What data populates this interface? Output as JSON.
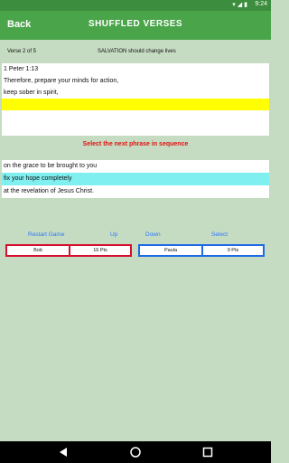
{
  "status": {
    "time": "9:24"
  },
  "header": {
    "back_label": "Back",
    "title": "SHUFFLED VERSES"
  },
  "info": {
    "progress": "Verse  2 of 5",
    "theme": "SALVATION should change lives"
  },
  "verse": {
    "lines": [
      "1 Peter 1:13",
      "Therefore, prepare your minds for action,",
      "keep sober in spirit,",
      "",
      ""
    ]
  },
  "instruction": "Select the next phrase in sequence",
  "options": [
    "on the grace to be brought to you",
    "fix your hope completely",
    "at the revelation of Jesus Christ."
  ],
  "controls": {
    "restart": "Restart Game",
    "up": "Up",
    "down": "Down",
    "select": "Select"
  },
  "players": [
    {
      "name": "Bob",
      "points": "16 Pts"
    },
    {
      "name": "Paula",
      "points": "9 Pts"
    }
  ],
  "colors": {
    "appbar": "#4aa44a",
    "statusbar": "#3c8d3d",
    "background": "#c6dcc2",
    "highlight": "#ffff00",
    "selected": "#80eff0",
    "instruction": "#e01010",
    "player1": "#d4102e",
    "player2": "#1f6ae6",
    "controls": "#2a78ff"
  }
}
